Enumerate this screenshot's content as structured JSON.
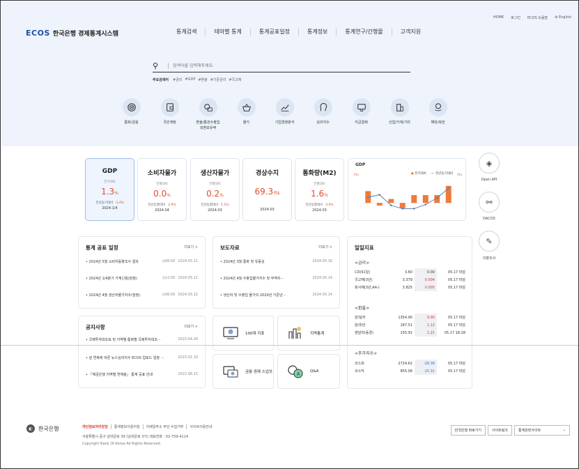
{
  "header": {
    "util": [
      "HOME",
      "로그인",
      "ECOS 도움말",
      "English"
    ],
    "logo_mark": "ECOS",
    "logo_title": "한국은행 경제통계시스템",
    "gnb": [
      "통계검색",
      "테마별 통계",
      "통계공표일정",
      "통계정보",
      "통계연구/간행물",
      "고객지원"
    ]
  },
  "search": {
    "placeholder": "검색어를 입력해주세요.",
    "kw_label": "주요검색어",
    "keywords": [
      "#금리",
      "#GDP",
      "#환율",
      "#기준금리",
      "#국고채"
    ]
  },
  "categories": [
    {
      "label": "통화/금융",
      "icon": "coin-icon"
    },
    {
      "label": "국민계정",
      "icon": "wallet-icon"
    },
    {
      "label": "환율/통관수출입\n외환보유액",
      "icon": "exchange-icon"
    },
    {
      "label": "물가",
      "icon": "basket-icon"
    },
    {
      "label": "기업경영분석",
      "icon": "growth-chart-icon"
    },
    {
      "label": "심리지수",
      "icon": "head-icon"
    },
    {
      "label": "지급결제",
      "icon": "card-icon"
    },
    {
      "label": "산업/가계/기타",
      "icon": "building-icon"
    },
    {
      "label": "해외/북한",
      "icon": "globe-hand-icon"
    }
  ],
  "indicators": [
    {
      "title": "GDP",
      "sub": "전기대비",
      "value": "1.3",
      "unit": "%",
      "prev_label": "전년동기대비",
      "prev_val": "3.4%",
      "date": "2024.1/4"
    },
    {
      "title": "소비자물가",
      "sub": "전월대비",
      "value": "0.0",
      "unit": "%",
      "prev_label": "전년동월대비",
      "prev_val": "2.9%",
      "date": "2024.04"
    },
    {
      "title": "생산자물가",
      "sub": "전월대비",
      "value": "0.2",
      "unit": "%",
      "prev_label": "전년동월대비",
      "prev_val": "1.5%",
      "date": "2024.03"
    },
    {
      "title": "경상수지",
      "sub": "",
      "value": "69.3",
      "unit": "억$",
      "prev_label": "",
      "prev_val": "",
      "date": "2024.03"
    },
    {
      "title": "통화량(M2)",
      "sub": "전월대비",
      "value": "1.6",
      "unit": "%",
      "prev_label": "전년동월대비",
      "prev_val": "4.9%",
      "date": "2024.03"
    }
  ],
  "gdp_chart": {
    "title": "GDP",
    "legend_bar": "전기대비",
    "legend_line": "전년동기대비",
    "axis_left_label": "(%)",
    "axis_right_label": "(%)"
  },
  "chart_data": {
    "type": "bar",
    "title": "GDP",
    "series": [
      {
        "name": "전기대비",
        "type": "bar",
        "values": [
          0.9,
          -0.2,
          0.3,
          -0.4,
          0.6,
          0.6,
          0.6,
          1.3
        ]
      },
      {
        "name": "전년동기대비",
        "type": "line",
        "values": [
          2.3,
          2.6,
          1.3,
          0.9,
          0.9,
          1.4,
          2.2,
          3.4
        ]
      }
    ]
  },
  "quick": [
    {
      "label": "Open API",
      "icon": "layers-icon"
    },
    {
      "label": "DACOS",
      "icon": "share-icon"
    },
    {
      "label": "의향조사",
      "icon": "survey-icon"
    }
  ],
  "schedule": {
    "title": "통계 공표 일정",
    "more": "더보기 >",
    "items": [
      {
        "text": "• 2024년 5월 소비자동향조사 결과",
        "time": "◷06:00",
        "date": "2024.05.21"
      },
      {
        "text": "• 2024년 1/4분기 가계신용(잠정)",
        "time": "◷12:00",
        "date": "2024.05.21"
      },
      {
        "text": "• 2024년 4월 생산자물가지수(잠정)",
        "time": "◷06:00",
        "date": "2024.05.22"
      }
    ]
  },
  "press": {
    "title": "보도자료",
    "more": "더보기 >",
    "items": [
      {
        "text": "• 2024년 3월 통화 및 유동성",
        "date": "2024.05.16"
      },
      {
        "text": "• 2024년 4월 수출입물가지수 및 무역지···",
        "date": "2024.05.14"
      },
      {
        "text": "• 생산자 및 수출입 물가의 2020년 기준년···",
        "date": "2024.05.14"
      }
    ]
  },
  "notice": {
    "title": "공지사항",
    "more": "더보기 >",
    "items": [
      {
        "text": "• 국제투자대조표 및 지역별·통화별 국제투자대조···",
        "date": "2023.04.28"
      },
      {
        "text": "• 설 연휴에 따른 뉴스심리지수 ECOS 업로드 일정 ···",
        "date": "2023.01.19"
      },
      {
        "text": "• 「예금은행 지역별 연체율」 통계 공표 안내",
        "date": "2022.06.15"
      }
    ]
  },
  "qbtns": [
    "100대 지표",
    "지역통계",
    "금융·경제 스냅샷",
    "Q&A"
  ],
  "daily": {
    "title": "일일지표",
    "groups": [
      {
        "name": "<금리>",
        "rows": [
          [
            "CD(91일)",
            "3.60",
            "0.00",
            "05.17 마감",
            "flat"
          ],
          [
            "국고채(3년)",
            "3.379",
            "0.004",
            "05.17 마감",
            "up"
          ],
          [
            "회사채(3년,AA-)",
            "3.825",
            "0.005",
            "05.17 마감",
            "up"
          ]
        ]
      },
      {
        "name": "<환율>",
        "rows": [
          [
            "원/달러",
            "1354.90",
            "9.90",
            "05.17 마감",
            "up"
          ],
          [
            "원/위안",
            "187.51",
            "1.12",
            "05.17 마감",
            "up"
          ],
          [
            "엔달러(동경)",
            "155.91",
            "1.21",
            "05.17 18:28",
            "up"
          ]
        ]
      },
      {
        "name": "<주가지수>",
        "rows": [
          [
            "코스피",
            "2724.62",
            "-28.38",
            "05.17 마감",
            "dn"
          ],
          [
            "코스닥",
            "855.06",
            "-15.31",
            "05.17 마감",
            "dn"
          ]
        ]
      }
    ]
  },
  "footer": {
    "logo": "한국은행",
    "links": [
      "개인정보처리방침",
      "통계정보이용지침",
      "이메일주소 무단 수집거부",
      "사이트이용안내"
    ],
    "address": "서울특별시 중구 남대문로 39 (남대문로 3가)  대표전화 : 02-759-4114",
    "copyright": "Copyright Bank Of Korea All Rights Reserved.",
    "btns": [
      "한국은행 바로가기",
      "사이트링크",
      "통계관련사이트"
    ]
  }
}
